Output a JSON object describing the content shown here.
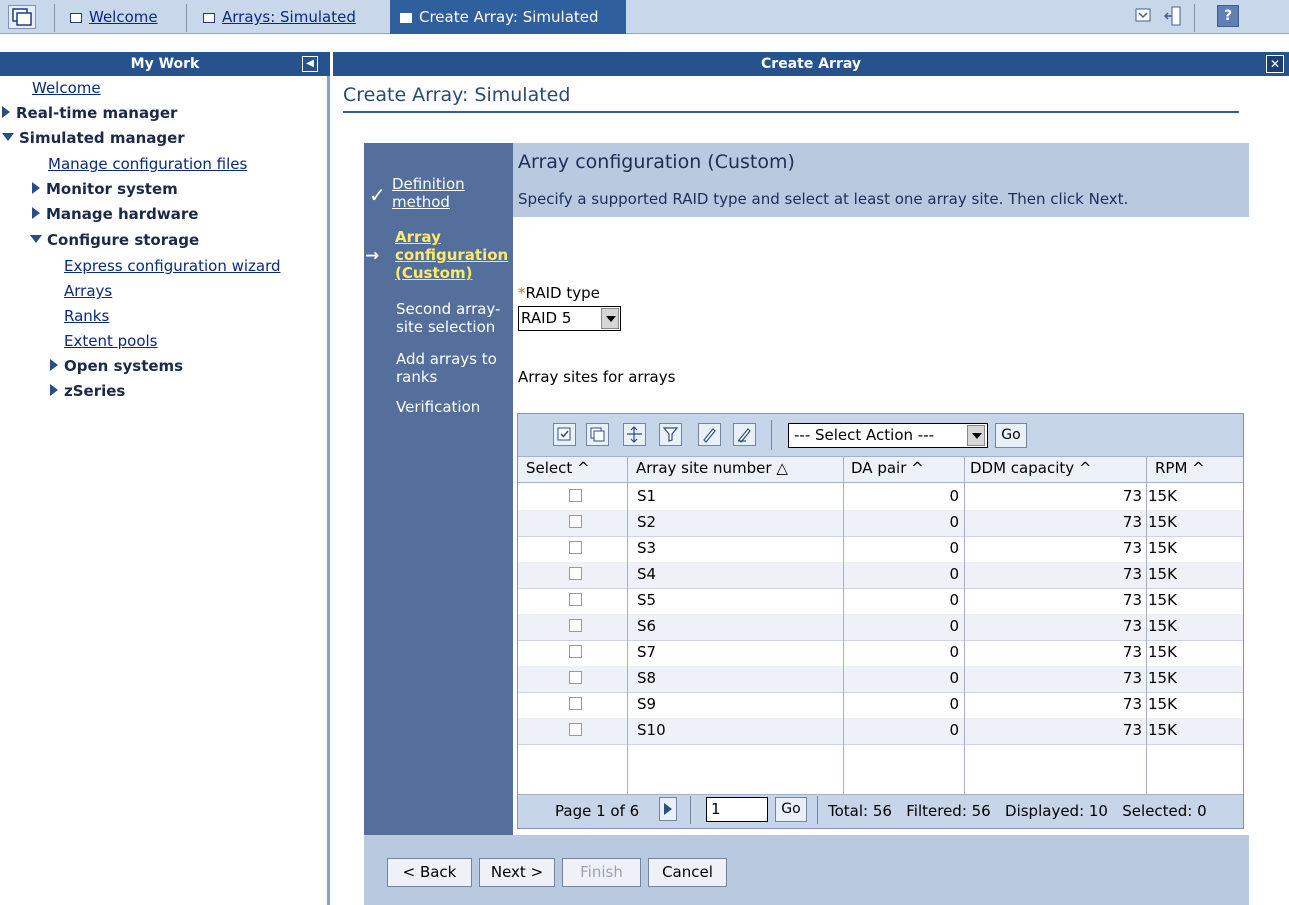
{
  "tabs": {
    "welcome": "Welcome",
    "arrays": "Arrays: Simulated",
    "create": "Create Array: Simulated",
    "help": "?"
  },
  "nav": {
    "header": "My Work",
    "items": [
      {
        "label": "Welcome"
      },
      {
        "label": "Real-time manager"
      },
      {
        "label": "Simulated manager"
      },
      {
        "label": "Manage configuration files"
      },
      {
        "label": "Monitor system"
      },
      {
        "label": "Manage hardware"
      },
      {
        "label": "Configure storage"
      },
      {
        "label": "Express configuration wizard"
      },
      {
        "label": "Arrays"
      },
      {
        "label": "Ranks"
      },
      {
        "label": "Extent pools"
      },
      {
        "label": "Open systems"
      },
      {
        "label": "zSeries"
      }
    ]
  },
  "main": {
    "header": "Create Array",
    "page_title": "Create Array: Simulated"
  },
  "wizard": {
    "steps": [
      {
        "label_1": "Definition",
        "label_2": "method"
      },
      {
        "label_1": "Array",
        "label_2": "configuration",
        "label_3": "(Custom)"
      },
      {
        "label_1": "Second array-",
        "label_2": "site selection"
      },
      {
        "label_1": "Add arrays to",
        "label_2": "ranks"
      },
      {
        "label_1": "Verification"
      }
    ],
    "title": "Array configuration (Custom)",
    "instructions": "Specify a supported RAID type and select at least one array site. Then click Next.",
    "raid_required_mark": "*",
    "raid_label": "RAID type",
    "raid_value": "RAID 5",
    "sites_label": "Array sites for arrays",
    "buttons": {
      "back": "< Back",
      "next": "Next >",
      "finish": "Finish",
      "cancel": "Cancel"
    }
  },
  "table": {
    "action_select": "--- Select Action ---",
    "go": "Go",
    "columns": [
      "Select ^",
      "Array site number △",
      "DA pair ^",
      "DDM capacity ^",
      "RPM ^"
    ],
    "rows": [
      {
        "site": "S1",
        "da": "0",
        "ddm": "73",
        "rpm": "15K"
      },
      {
        "site": "S2",
        "da": "0",
        "ddm": "73",
        "rpm": "15K"
      },
      {
        "site": "S3",
        "da": "0",
        "ddm": "73",
        "rpm": "15K"
      },
      {
        "site": "S4",
        "da": "0",
        "ddm": "73",
        "rpm": "15K"
      },
      {
        "site": "S5",
        "da": "0",
        "ddm": "73",
        "rpm": "15K"
      },
      {
        "site": "S6",
        "da": "0",
        "ddm": "73",
        "rpm": "15K"
      },
      {
        "site": "S7",
        "da": "0",
        "ddm": "73",
        "rpm": "15K"
      },
      {
        "site": "S8",
        "da": "0",
        "ddm": "73",
        "rpm": "15K"
      },
      {
        "site": "S9",
        "da": "0",
        "ddm": "73",
        "rpm": "15K"
      },
      {
        "site": "S10",
        "da": "0",
        "ddm": "73",
        "rpm": "15K"
      }
    ],
    "pager": {
      "page_text": "Page 1 of 6",
      "page_input": "1",
      "go": "Go",
      "stats": "Total: 56   Filtered: 56   Displayed: 10   Selected: 0"
    }
  }
}
